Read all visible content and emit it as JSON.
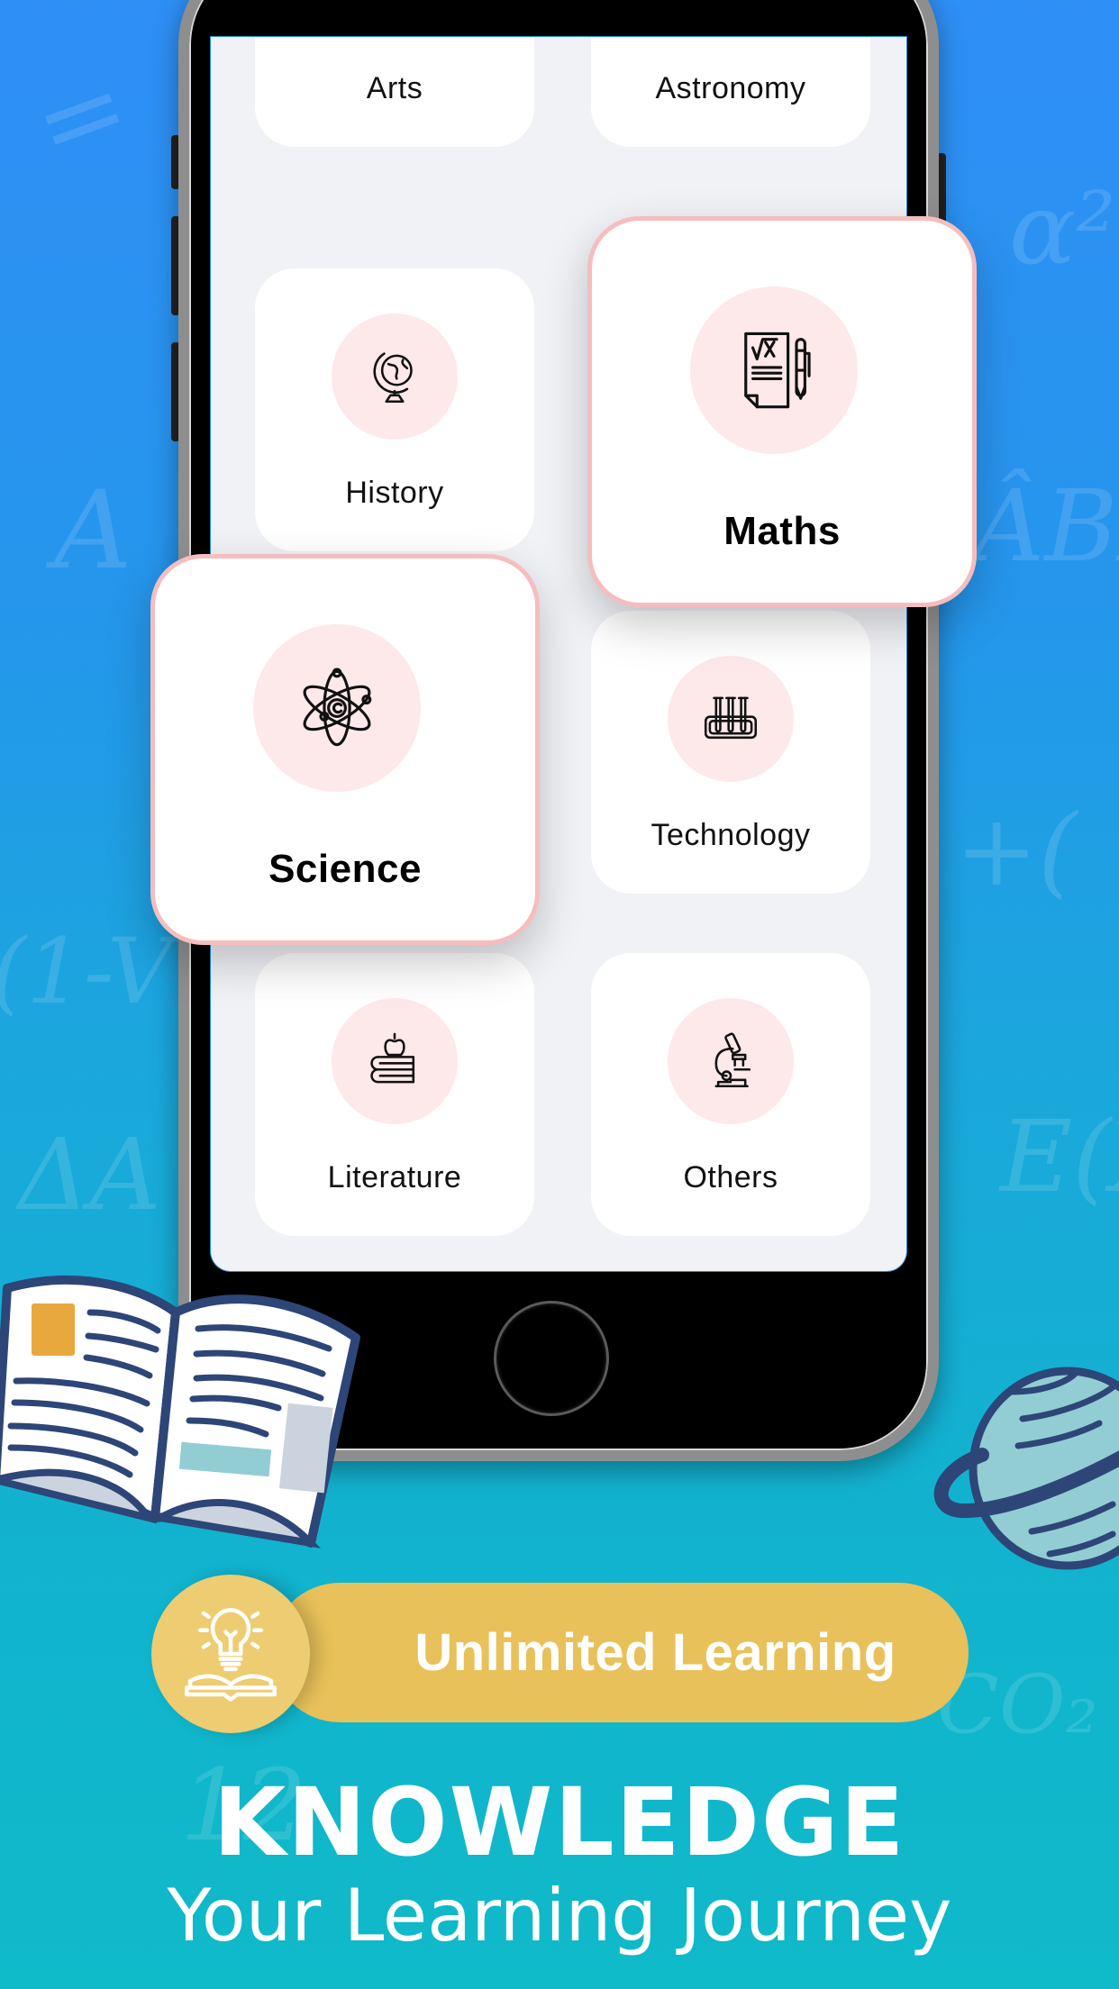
{
  "background": {
    "chalk_marks": [
      "=",
      "2",
      "α²",
      "ÂBD",
      "A",
      "(1-V",
      "ΔA",
      "+(",
      "E(X",
      "12",
      "CO₂"
    ]
  },
  "categories": [
    {
      "label": "Arts",
      "icon": "palette-icon",
      "featured": false
    },
    {
      "label": "Astronomy",
      "icon": "telescope-icon",
      "featured": false
    },
    {
      "label": "History",
      "icon": "globe-icon",
      "featured": false
    },
    {
      "label": "Maths",
      "icon": "math-notes-icon",
      "featured": true
    },
    {
      "label": "Science",
      "icon": "atom-icon",
      "featured": true
    },
    {
      "label": "Technology",
      "icon": "test-tubes-icon",
      "featured": false
    },
    {
      "label": "Literature",
      "icon": "books-apple-icon",
      "featured": false
    },
    {
      "label": "Others",
      "icon": "microscope-icon",
      "featured": false
    }
  ],
  "banner": {
    "label": "Unlimited Learning",
    "icon": "lightbulb-book-icon"
  },
  "headline": "KNOWLEDGE",
  "subline": "Your Learning Journey",
  "colors": {
    "background_top": "#2f8ff6",
    "background_bottom": "#0fbac9",
    "card_icon_bg": "#fde8ea",
    "featured_border": "#f6bdbe",
    "banner": "#e8c15a",
    "illustration_navy": "#2d4677"
  }
}
